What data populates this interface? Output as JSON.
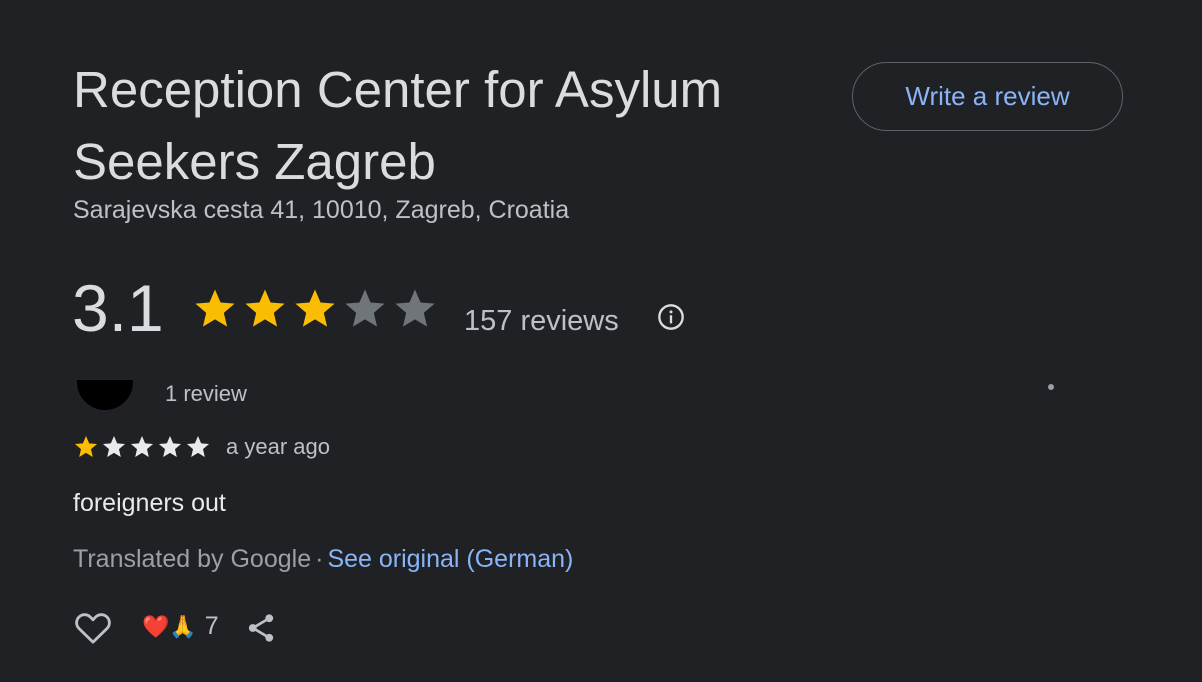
{
  "place": {
    "title": "Reception Center for Asylum Seekers Zagreb",
    "address": "Sarajevska cesta 41, 10010, Zagreb, Croatia",
    "write_review_label": "Write a review",
    "rating": "3.1",
    "rating_stars": 3,
    "reviews_count_label": "157 reviews"
  },
  "review": {
    "reviewer_meta": "1 review",
    "stars": 1,
    "time": "a year ago",
    "text": "foreigners out",
    "translated_label": "Translated by Google",
    "separator": "·",
    "see_original_label": "See original (German)",
    "reaction_emojis": "❤️🙏",
    "reaction_count": "7"
  },
  "colors": {
    "background": "#202124",
    "star_filled": "#fbbc04",
    "star_empty_big": "#70757a",
    "star_empty_small": "#e8eaed",
    "link": "#8ab4f8"
  },
  "icons": {
    "info": "info-icon",
    "like": "heart-icon",
    "share": "share-icon",
    "star": "star-icon"
  }
}
